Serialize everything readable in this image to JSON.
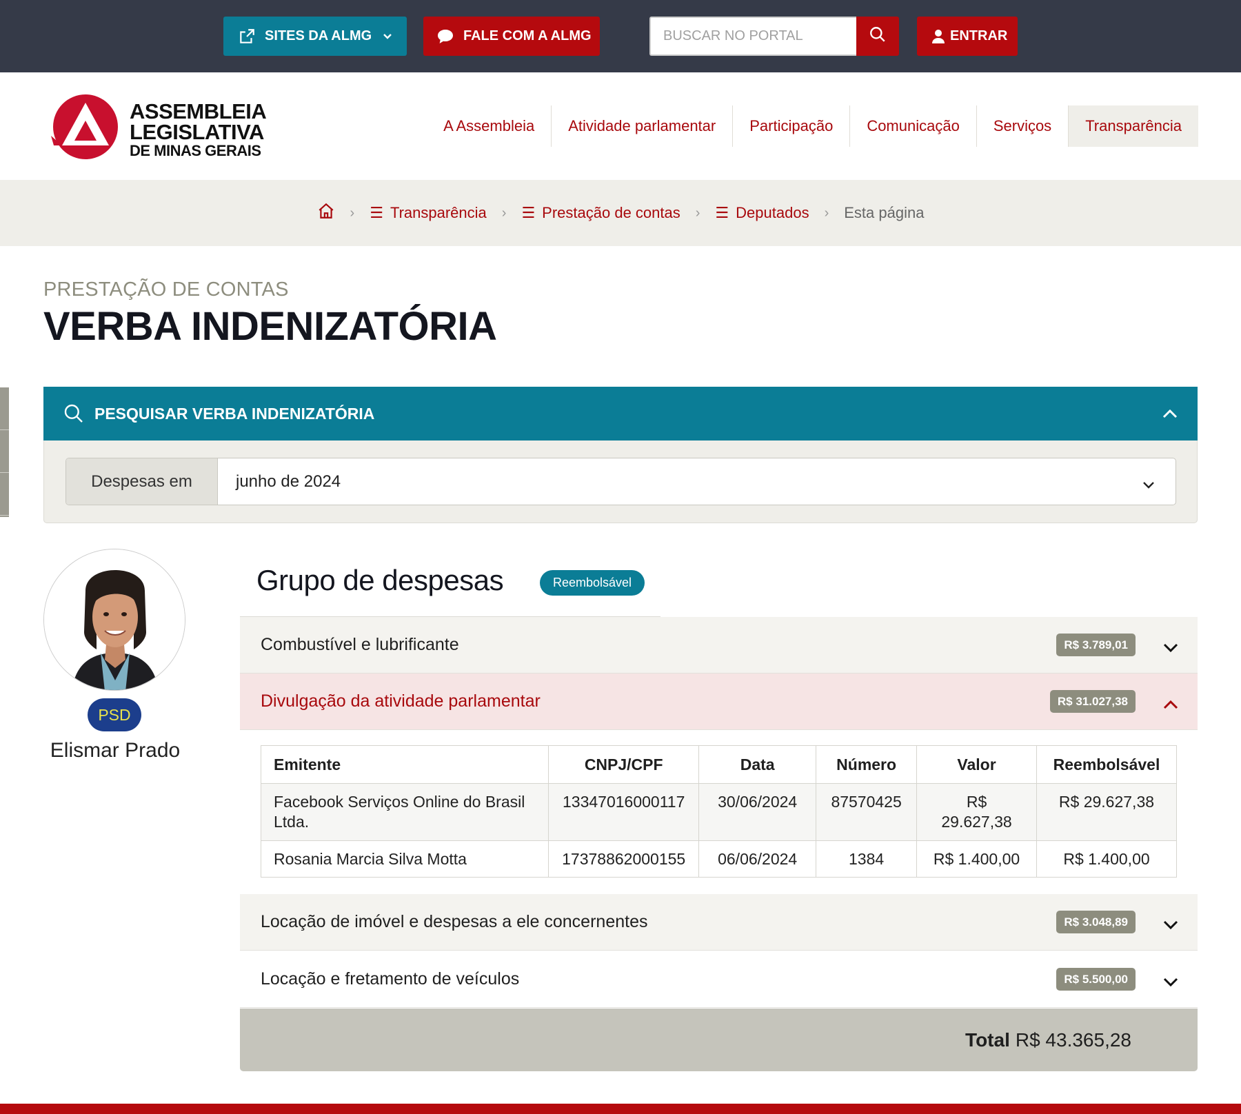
{
  "topbar": {
    "sites_label": "SITES DA ALMG",
    "fale_label": "FALE COM A ALMG",
    "search_placeholder": "BUSCAR NO PORTAL",
    "entrar_label": "ENTRAR"
  },
  "logo": {
    "line1": "ASSEMBLEIA",
    "line2": "LEGISLATIVA",
    "line3": "DE MINAS GERAIS"
  },
  "nav": {
    "items": [
      {
        "label": "A Assembleia"
      },
      {
        "label": "Atividade parlamentar"
      },
      {
        "label": "Participação"
      },
      {
        "label": "Comunicação"
      },
      {
        "label": "Serviços"
      },
      {
        "label": "Transparência"
      }
    ]
  },
  "breadcrumb": {
    "items": [
      "Transparência",
      "Prestação de contas",
      "Deputados"
    ],
    "current": "Esta página"
  },
  "page": {
    "kicker": "PRESTAÇÃO DE CONTAS",
    "title": "VERBA INDENIZATÓRIA"
  },
  "search_panel": {
    "title": "PESQUISAR VERBA INDENIZATÓRIA",
    "filter_label": "Despesas em",
    "filter_value": "junho de 2024"
  },
  "deputy": {
    "party": "PSD",
    "name": "Elismar Prado"
  },
  "group": {
    "title": "Grupo de despesas",
    "badge": "Reembolsável",
    "categories": [
      {
        "label": "Combustível e lubrificante",
        "amount": "R$ 3.789,01",
        "expanded": false
      },
      {
        "label": "Divulgação da atividade parlamentar",
        "amount": "R$ 31.027,38",
        "expanded": true
      },
      {
        "label": "Locação de imóvel e despesas a ele concernentes",
        "amount": "R$ 3.048,89",
        "expanded": false
      },
      {
        "label": "Locação e fretamento de veículos",
        "amount": "R$ 5.500,00",
        "expanded": false
      }
    ],
    "table": {
      "headers": [
        "Emitente",
        "CNPJ/CPF",
        "Data",
        "Número",
        "Valor",
        "Reembolsável"
      ],
      "rows": [
        [
          "Facebook Serviços Online do Brasil Ltda.",
          "13347016000117",
          "30/06/2024",
          "87570425",
          "R$ 29.627,38",
          "R$ 29.627,38"
        ],
        [
          "Rosania Marcia Silva Motta",
          "17378862000155",
          "06/06/2024",
          "1384",
          "R$ 1.400,00",
          "R$ 1.400,00"
        ]
      ]
    },
    "total_label": "Total",
    "total_value": "R$ 43.365,28"
  },
  "colors": {
    "topbar": "#353a48",
    "teal": "#0b7d96",
    "red": "#b50a0e",
    "beige": "#efeee9"
  }
}
